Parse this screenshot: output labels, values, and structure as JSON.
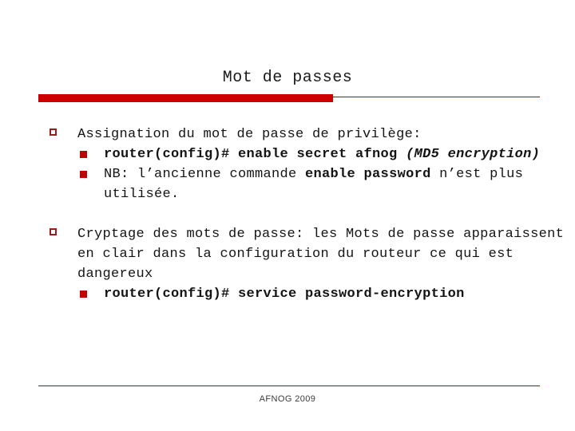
{
  "slide": {
    "title": "Mot de passes",
    "accent_color": "#CC0000",
    "rule_color": "#7a1a1a",
    "bullet_l1_color": "#9E1B1B",
    "bullet_l2_color": "#C00000",
    "text_color": "#141414",
    "background": "#ffffff"
  },
  "content": {
    "group1": {
      "heading": "Assignation du mot de passe de privilège:",
      "sub1": {
        "command": "router(config)# enable secret afnog ",
        "annotation": "(MD5 encryption)"
      },
      "sub2": {
        "prefix": "NB: l’ancienne commande ",
        "bold": "enable password",
        "suffix": " n’est plus utilisée."
      }
    },
    "group2": {
      "heading": "Cryptage des mots de passe: les Mots de passe apparaissent en clair dans la configuration du routeur ce qui est dangereux",
      "sub1": {
        "command": "router(config)# service password-encryption"
      }
    }
  },
  "footer": {
    "label": "AFNOG 2009"
  }
}
